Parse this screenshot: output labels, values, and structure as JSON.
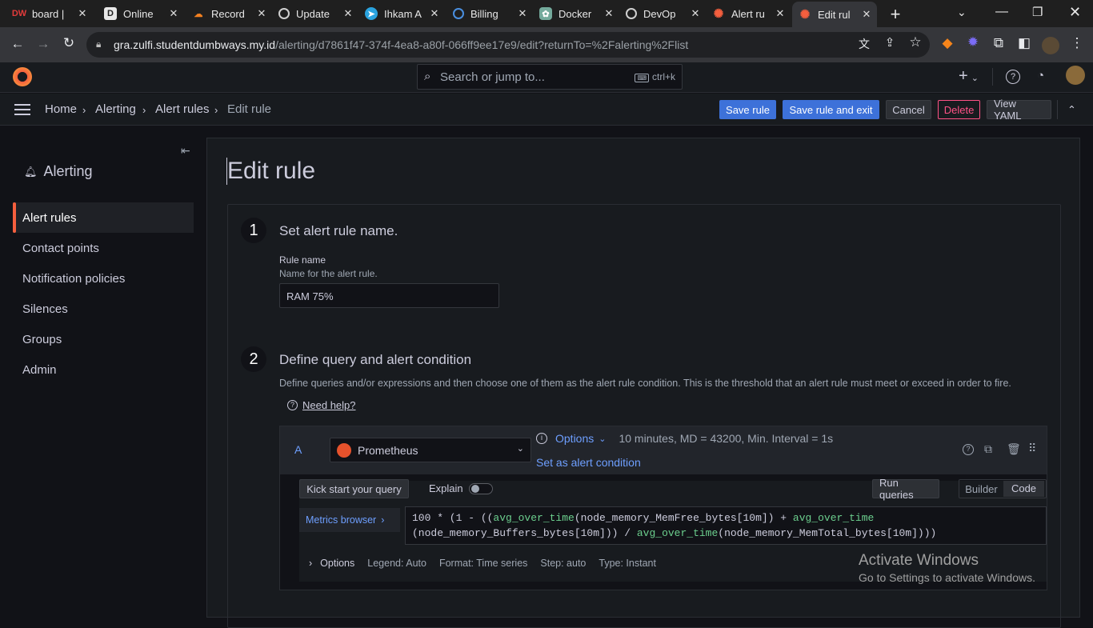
{
  "browser": {
    "tabs": [
      {
        "title": "board |",
        "icon": "dumbways-icon"
      },
      {
        "title": "Online",
        "icon": "d-icon"
      },
      {
        "title": "Record",
        "icon": "cloudflare-icon"
      },
      {
        "title": "Update",
        "icon": "github-icon"
      },
      {
        "title": "Ihkam A",
        "icon": "telegram-icon"
      },
      {
        "title": "Billing",
        "icon": "billing-icon"
      },
      {
        "title": "Docker",
        "icon": "openai-icon"
      },
      {
        "title": "DevOp",
        "icon": "github-icon"
      },
      {
        "title": "Alert ru",
        "icon": "grafana-icon"
      },
      {
        "title": "Edit rul",
        "icon": "grafana-icon"
      }
    ],
    "url_host": "gra.zulfi.studentdumbways.my.id",
    "url_path": "/alerting/d7861f47-374f-4ea8-a80f-066ff9ee17e9/edit?returnTo=%2Falerting%2Flist"
  },
  "topnav": {
    "search_placeholder": "Search or jump to...",
    "shortcut": "ctrl+k"
  },
  "breadcrumb": [
    "Home",
    "Alerting",
    "Alert rules",
    "Edit rule"
  ],
  "toolbar": {
    "save_rule": "Save rule",
    "save_exit": "Save rule and exit",
    "cancel": "Cancel",
    "delete": "Delete",
    "view_yaml": "View YAML"
  },
  "sidebar": {
    "title": "Alerting",
    "items": [
      "Alert rules",
      "Contact points",
      "Notification policies",
      "Silences",
      "Groups",
      "Admin"
    ]
  },
  "main": {
    "title": "Edit rule",
    "step1": {
      "num": "1",
      "title": "Set alert rule name.",
      "label": "Rule name",
      "desc": "Name for the alert rule.",
      "value": "RAM 75%"
    },
    "step2": {
      "num": "2",
      "title": "Define query and alert condition",
      "desc": "Define queries and/or expressions and then choose one of them as the alert rule condition. This is the threshold that an alert rule must meet or exceed in order to fire.",
      "help": "Need help?"
    },
    "query": {
      "ref": "A",
      "datasource": "Prometheus",
      "options": "Options",
      "options_summary": "10 minutes, MD = 43200, Min. Interval = 1s",
      "set_condition": "Set as alert condition",
      "kickstart": "Kick start your query",
      "explain": "Explain",
      "run": "Run queries",
      "builder": "Builder",
      "code": "Code",
      "metrics_browser": "Metrics browser",
      "options_label": "Options",
      "legend": "Legend: Auto",
      "format": "Format: Time series",
      "step": "Step: auto",
      "type": "Type: Instant"
    }
  },
  "watermark": {
    "title": "Activate Windows",
    "sub": "Go to Settings to activate Windows."
  }
}
